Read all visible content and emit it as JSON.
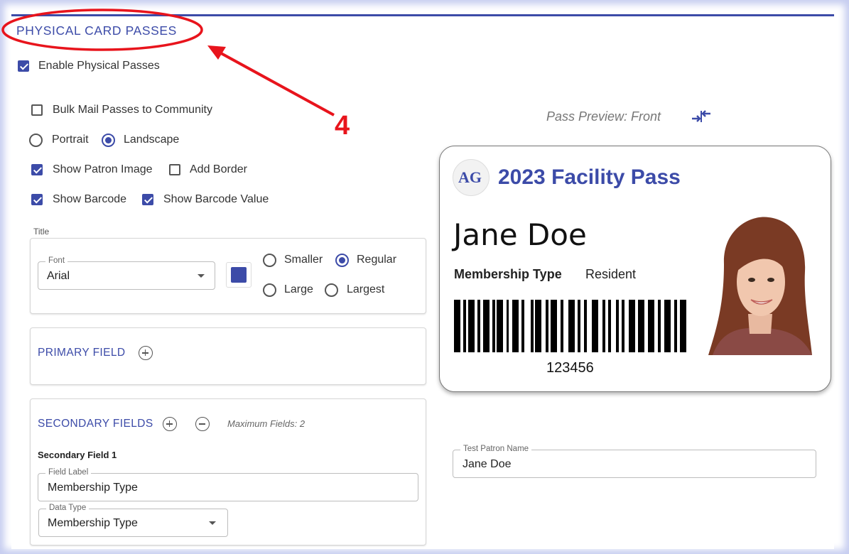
{
  "section": {
    "title": "PHYSICAL CARD PASSES"
  },
  "annotation": {
    "step_number": "4",
    "color": "#e8141c"
  },
  "enable_physical": {
    "label": "Enable Physical Passes",
    "checked": true
  },
  "bulk_mail": {
    "label": "Bulk Mail Passes to Community",
    "checked": false
  },
  "orientation": {
    "portrait": "Portrait",
    "landscape": "Landscape",
    "selected": "Landscape"
  },
  "options": {
    "show_patron_image": "Show Patron Image",
    "add_border": "Add Border",
    "show_barcode": "Show Barcode",
    "show_barcode_value": "Show Barcode Value"
  },
  "title_group": {
    "label": "Title",
    "font_legend": "Font",
    "font_value": "Arial",
    "color": "#3c4ba8",
    "sizes": {
      "smaller": "Smaller",
      "regular": "Regular",
      "large": "Large",
      "largest": "Largest",
      "selected": "Regular"
    }
  },
  "primary": {
    "title": "PRIMARY FIELD"
  },
  "secondary": {
    "title": "SECONDARY FIELDS",
    "max_note": "Maximum Fields: 2",
    "field1_heading": "Secondary Field 1",
    "label_legend": "Field Label",
    "label_value": "Membership Type",
    "type_legend": "Data Type",
    "type_value": "Membership Type"
  },
  "preview": {
    "title": "Pass Preview: Front",
    "card_title": "2023 Facility Pass",
    "logo_text": "AG",
    "patron_name": "Jane Doe",
    "field_label": "Membership Type",
    "field_value": "Resident",
    "barcode_value": "123456"
  },
  "test_patron": {
    "legend": "Test Patron Name",
    "value": "Jane Doe"
  },
  "accent": "#3c4ba8"
}
